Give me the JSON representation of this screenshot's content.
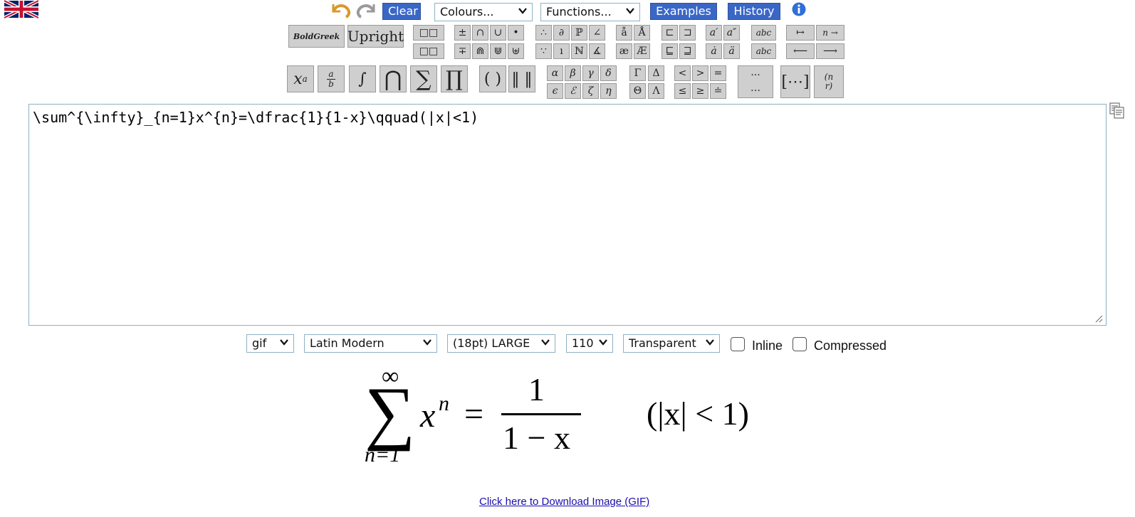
{
  "toolbar": {
    "clear_label": "Clear",
    "colours_value": "Colours...",
    "functions_value": "Functions...",
    "examples_label": "Examples",
    "history_label": "History",
    "boldgreek_label": "BoldGreek",
    "upright_label": "Upright"
  },
  "editor": {
    "value": "\\sum^{\\infty}_{n=1}x^{n}=\\dfrac{1}{1-x}\\qquad(|x|<1)"
  },
  "options": {
    "format": "gif",
    "font": "Latin Modern",
    "size": "(18pt) LARGE",
    "dpi": "110",
    "background": "Transparent",
    "inline_label": "Inline",
    "compressed_label": "Compressed"
  },
  "preview": {
    "upper_limit": "∞",
    "summation": "∑",
    "term": "x",
    "exponent": "n",
    "equals": "=",
    "numerator": "1",
    "denominator": "1 − x",
    "condition": "(|x| < 1)",
    "lower_limit": "n=1"
  },
  "download_link": "Click here to Download Image (GIF)",
  "icons": [
    "uk-flag-icon",
    "undo-icon",
    "redo-icon",
    "info-icon",
    "copy-icon",
    "resize-handle-icon",
    "chevron-down-icon"
  ],
  "colors": {
    "button_blue": "#3a67c6",
    "toolbar_grey": "#cfcfcf",
    "field_border": "#8fb1c3",
    "link": "#1a0dab"
  }
}
